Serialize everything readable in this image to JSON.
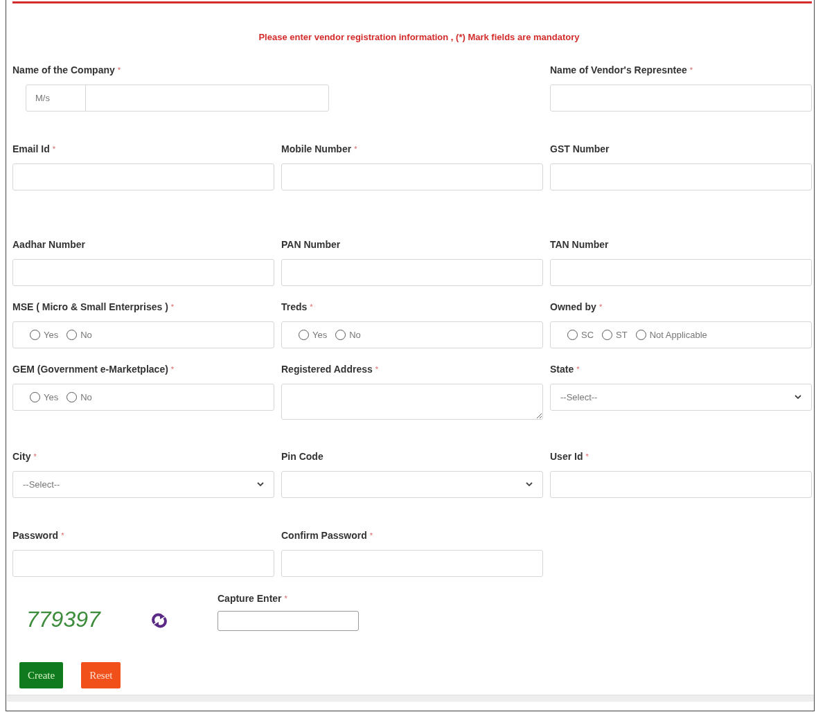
{
  "notice": "Please enter vendor registration information , (*) Mark fields are mandatory",
  "company_row": [
    {
      "kind": "prefix",
      "label": "Name of the Company",
      "mark": "*",
      "prefix": "M/s"
    },
    {
      "kind": "text",
      "label": "Name of Vendor's Represntee",
      "mark": "*"
    }
  ],
  "rows": [
    [
      {
        "kind": "text",
        "label": "Email Id",
        "mark": "*"
      },
      {
        "kind": "text",
        "label": "Mobile Number",
        "mark": "*"
      },
      {
        "kind": "text",
        "label": "GST Number"
      }
    ],
    [
      {
        "kind": "text",
        "label": "Aadhar Number"
      },
      {
        "kind": "text",
        "label": "PAN Number"
      },
      {
        "kind": "text",
        "label": "TAN Number"
      }
    ],
    [
      {
        "kind": "radio",
        "label": "MSE ( Micro & Small Enterprises )",
        "mark": "*",
        "options": [
          {
            "label": "Yes",
            "selected": false
          },
          {
            "label": "No",
            "selected": false
          }
        ]
      },
      {
        "kind": "radio",
        "label": "Treds",
        "mark": "*",
        "options": [
          {
            "label": "Yes",
            "selected": false
          },
          {
            "label": "No",
            "selected": false
          }
        ]
      },
      {
        "kind": "radio",
        "label": "Owned by",
        "mark": "*",
        "options": [
          {
            "label": "SC",
            "selected": false
          },
          {
            "label": "ST",
            "selected": false
          },
          {
            "label": "Not Applicable",
            "selected": false
          }
        ]
      }
    ],
    [
      {
        "kind": "radio",
        "label": "GEM (Government e-Marketplace)",
        "mark": "*",
        "options": [
          {
            "label": "Yes",
            "selected": false
          },
          {
            "label": "No",
            "selected": false
          }
        ]
      },
      {
        "kind": "textarea",
        "label": "Registered Address",
        "mark": "*"
      },
      {
        "kind": "select",
        "label": "State",
        "mark": "*",
        "value": "--Select--"
      }
    ],
    [
      {
        "kind": "select",
        "label": "City",
        "mark": "*",
        "value": "--Select--"
      },
      {
        "kind": "select",
        "label": "Pin Code"
      },
      {
        "kind": "text",
        "label": "User Id",
        "mark": "*"
      }
    ],
    [
      {
        "kind": "text",
        "label": "Password",
        "mark": "*"
      },
      {
        "kind": "text",
        "label": "Confirm Password",
        "mark": "*"
      }
    ]
  ],
  "captcha": {
    "code": "779397",
    "label": "Capture Enter",
    "mark": "*"
  },
  "buttons": [
    {
      "kind": "create",
      "label": "Create"
    },
    {
      "kind": "reset",
      "label": "Reset"
    }
  ]
}
